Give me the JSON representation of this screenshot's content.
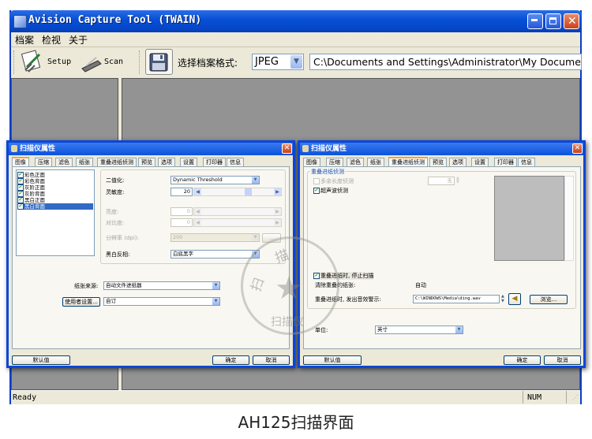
{
  "window": {
    "title": "Avision Capture Tool (TWAIN)",
    "icons": {
      "app": "scanner-app-icon",
      "minimize": "minimize-icon",
      "maximize": "maximize-icon",
      "close": "close-icon"
    }
  },
  "menu": {
    "items": [
      "档案",
      "检视",
      "关于"
    ]
  },
  "toolbar": {
    "setup_label": "Setup",
    "scan_label": "Scan",
    "format_label": "选择档案格式:",
    "format_value": "JPEG",
    "path_value": "C:\\Documents and Settings\\Administrator\\My Documents\\My"
  },
  "statusbar": {
    "left": "Ready",
    "right": "NUM"
  },
  "caption": "AH125扫描界面",
  "dialog_left": {
    "title": "扫描仪属性",
    "tabs": [
      "图像",
      "压缩",
      "滤色",
      "纸张",
      "重叠进纸侦测",
      "预览",
      "选项",
      "设置",
      "打印器",
      "信息"
    ],
    "active_tab": "图像",
    "image_list": [
      {
        "label": "彩色正面",
        "checked": true,
        "selected": false
      },
      {
        "label": "彩色背面",
        "checked": true,
        "selected": false
      },
      {
        "label": "灰阶正面",
        "checked": true,
        "selected": false
      },
      {
        "label": "灰阶背面",
        "checked": true,
        "selected": false
      },
      {
        "label": "黑白正面",
        "checked": true,
        "selected": false
      },
      {
        "label": "黑白背面",
        "checked": true,
        "selected": true
      }
    ],
    "binarization_label": "二值化:",
    "binarization_value": "Dynamic Threshold",
    "sensitivity_label": "灵敏度:",
    "sensitivity_value": "20",
    "brightness_label": "亮度:",
    "brightness_value": "0",
    "contrast_label": "对比度:",
    "contrast_value": "0",
    "resolution_label": "分辨率 (dpi):",
    "resolution_value": "200",
    "resolution_more": "...",
    "invert_label": "黑白反相:",
    "invert_value": "白底黑字",
    "paper_source_label": "纸张来源:",
    "paper_source_value": "自动文件进纸器",
    "user_settings_button": "使用者设置...",
    "user_settings_value": "自订",
    "default_button": "默认值",
    "ok_button": "确定",
    "cancel_button": "取消"
  },
  "dialog_right": {
    "title": "扫描仪属性",
    "tabs": [
      "图像",
      "压缩",
      "滤色",
      "纸张",
      "重叠进纸侦测",
      "预览",
      "选项",
      "设置",
      "打印器",
      "信息"
    ],
    "active_tab": "重叠进纸侦测",
    "group_label": "重叠进纸侦测",
    "length_detect_label": "多余长度侦测",
    "length_detect_checked": false,
    "length_detect_value": "无",
    "ultrasonic_label": "超声波侦测",
    "ultrasonic_checked": true,
    "stop_scan_label": "重叠进纸时, 停止扫描",
    "stop_scan_checked": true,
    "clear_label": "清除重叠的纸张:",
    "clear_value": "自动",
    "sound_label": "重叠进纸时, 发出音效警示:",
    "sound_path": "C:\\WINDOWS\\Media\\ding.wav",
    "browse_button": "浏览...",
    "unit_label": "单位:",
    "unit_value": "英寸",
    "default_button": "默认值",
    "ok_button": "确定",
    "cancel_button": "取消"
  },
  "watermark": {
    "text_top": "描",
    "text_left": "扫",
    "text_bottom": "扫描仪"
  }
}
